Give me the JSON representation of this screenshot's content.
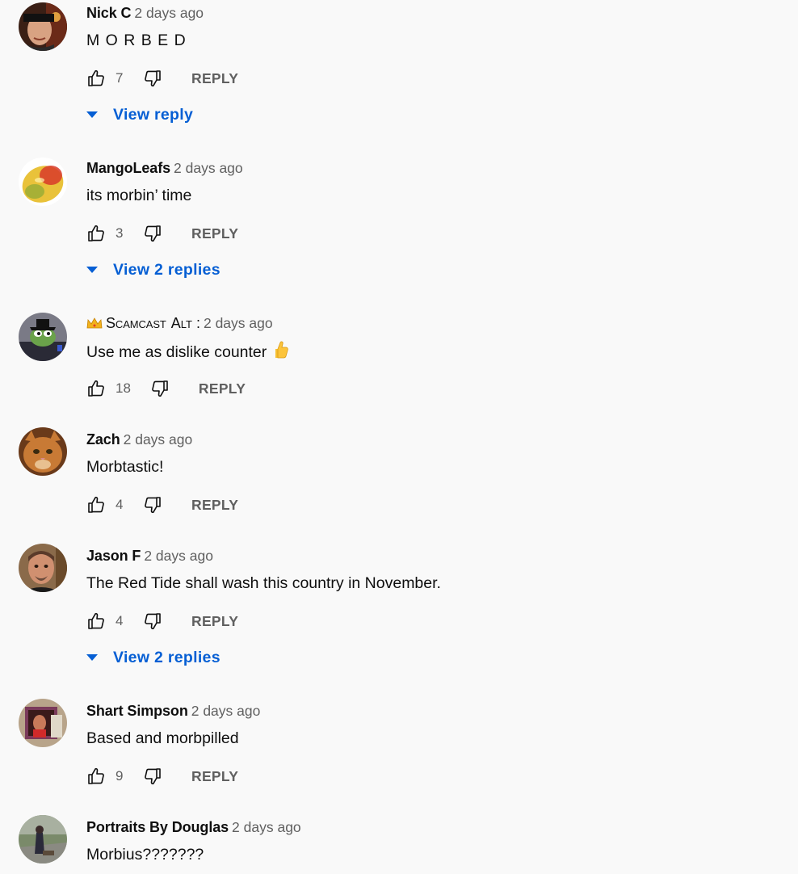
{
  "comments": [
    {
      "author": "Nick C",
      "time": "2 days ago",
      "text": "M O R B E D",
      "likes": "7",
      "reply_label": "REPLY",
      "view_replies": "View reply"
    },
    {
      "author": "MangoLeafs",
      "time": "2 days ago",
      "text": "its morbin’ time",
      "likes": "3",
      "reply_label": "REPLY",
      "view_replies": "View 2 replies"
    },
    {
      "author": "Scamcast",
      "author_suffix": "Alt :",
      "time": "2 days ago",
      "text": "Use me as dislike counter",
      "likes": "18",
      "reply_label": "REPLY"
    },
    {
      "author": "Zach",
      "time": "2 days ago",
      "text": "Morbtastic!",
      "likes": "4",
      "reply_label": "REPLY"
    },
    {
      "author": "Jason F",
      "time": "2 days ago",
      "text": "The Red Tide shall wash this country in November.",
      "likes": "4",
      "reply_label": "REPLY",
      "view_replies": "View 2 replies"
    },
    {
      "author": "Shart Simpson",
      "time": "2 days ago",
      "text": "Based and morbpilled",
      "likes": "9",
      "reply_label": "REPLY"
    },
    {
      "author": "Portraits By Douglas",
      "time": "2 days ago",
      "text": "Morbius???????"
    }
  ],
  "colors": {
    "background": "#f9f9f9",
    "link_blue": "#065fd4",
    "secondary_text": "#606060",
    "primary_text": "#0f0f0f"
  },
  "icons": {
    "like": "thumb-up-outline-icon",
    "dislike": "thumb-down-outline-icon",
    "expand": "caret-down-icon",
    "crown": "crown-icon",
    "emoji": "thumbs-up-emoji-icon"
  }
}
